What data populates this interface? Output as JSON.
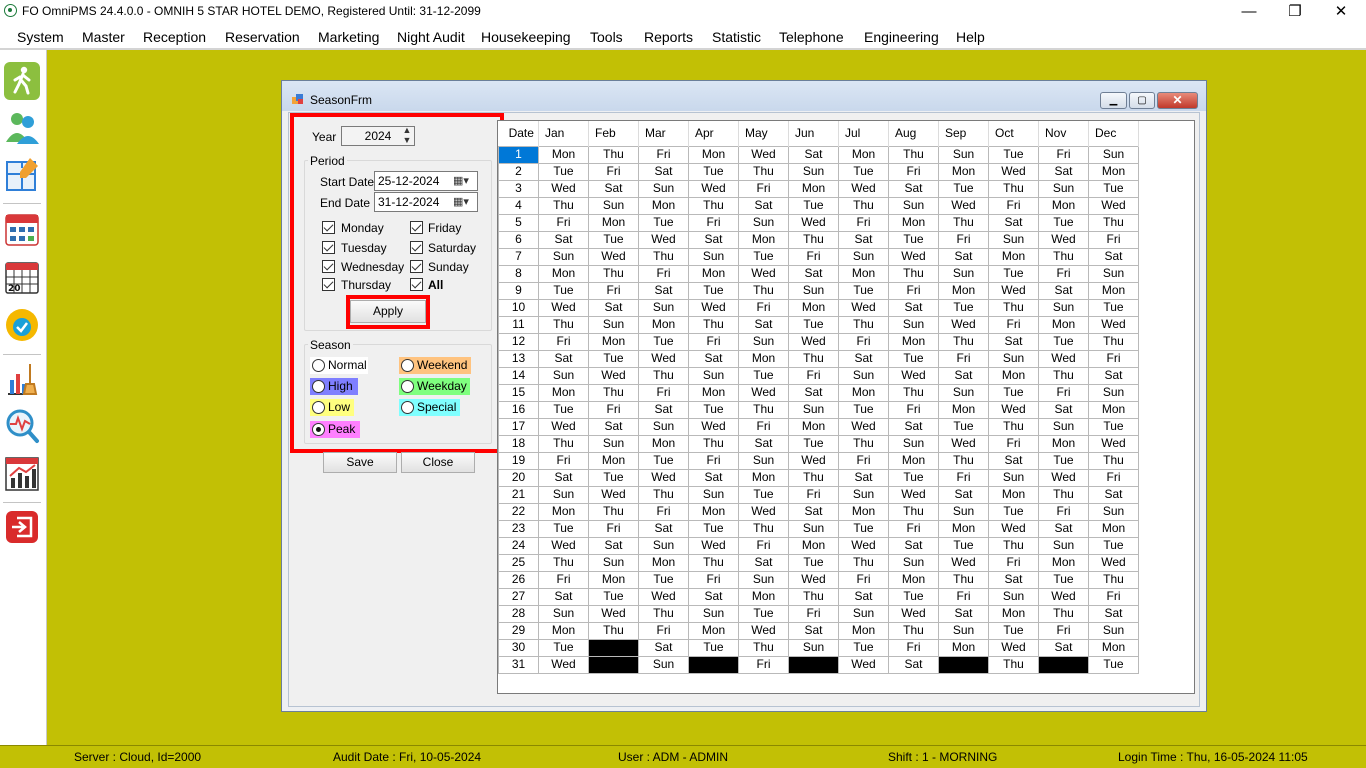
{
  "window": {
    "title": "FO OmniPMS 24.4.0.0 - OMNIH 5 STAR HOTEL DEMO, Registered Until: 31-12-2099"
  },
  "menu": [
    "System",
    "Master",
    "Reception",
    "Reservation",
    "Marketing",
    "Night Audit",
    "Housekeeping",
    "Tools",
    "Reports",
    "Statistic",
    "Telephone",
    "Engineering",
    "Help"
  ],
  "toolbar": [
    "walk-in-icon",
    "guests-icon",
    "floor-plan-icon",
    "calendar-grid-icon",
    "calendar-2023-icon",
    "badge-check-icon",
    "housekeeping-icon",
    "analytics-icon",
    "chart-icon",
    "exit-icon"
  ],
  "status": {
    "server": "Server : Cloud, Id=2000",
    "audit": "Audit Date : Fri, 10-05-2024",
    "user": "User : ADM - ADMIN",
    "shift": "Shift : 1 - MORNING",
    "login": "Login Time : Thu, 16-05-2024 11:05"
  },
  "dialog": {
    "title": "SeasonFrm",
    "year_label": "Year",
    "year_value": "2024",
    "period_label": "Period",
    "start_label": "Start Date",
    "start_value": "25-12-2024",
    "end_label": "End Date",
    "end_value": "31-12-2024",
    "days": {
      "monday": "Monday",
      "tuesday": "Tuesday",
      "wednesday": "Wednesday",
      "thursday": "Thursday",
      "friday": "Friday",
      "saturday": "Saturday",
      "sunday": "Sunday",
      "all": "All"
    },
    "apply_label": "Apply",
    "season_label": "Season",
    "seasons": {
      "normal": "Normal",
      "high": "High",
      "low": "Low",
      "peak": "Peak",
      "weekend": "Weekend",
      "weekday": "Weekday",
      "special": "Special"
    },
    "selected_season": "Peak",
    "season_colors": {
      "normal": "#ffffff",
      "high": "#7f7fff",
      "low": "#ffff7f",
      "peak": "#ff7fff",
      "weekend": "#ffc37f",
      "weekday": "#7fff7f",
      "special": "#7fffff"
    },
    "save_label": "Save",
    "close_label": "Close"
  },
  "grid": {
    "columns": [
      "Date",
      "Jan",
      "Feb",
      "Mar",
      "Apr",
      "May",
      "Jun",
      "Jul",
      "Aug",
      "Sep",
      "Oct",
      "Nov",
      "Dec"
    ],
    "rows": [
      [
        "1",
        "Mon",
        "Thu",
        "Fri",
        "Mon",
        "Wed",
        "Sat",
        "Mon",
        "Thu",
        "Sun",
        "Tue",
        "Fri",
        "Sun"
      ],
      [
        "2",
        "Tue",
        "Fri",
        "Sat",
        "Tue",
        "Thu",
        "Sun",
        "Tue",
        "Fri",
        "Mon",
        "Wed",
        "Sat",
        "Mon"
      ],
      [
        "3",
        "Wed",
        "Sat",
        "Sun",
        "Wed",
        "Fri",
        "Mon",
        "Wed",
        "Sat",
        "Tue",
        "Thu",
        "Sun",
        "Tue"
      ],
      [
        "4",
        "Thu",
        "Sun",
        "Mon",
        "Thu",
        "Sat",
        "Tue",
        "Thu",
        "Sun",
        "Wed",
        "Fri",
        "Mon",
        "Wed"
      ],
      [
        "5",
        "Fri",
        "Mon",
        "Tue",
        "Fri",
        "Sun",
        "Wed",
        "Fri",
        "Mon",
        "Thu",
        "Sat",
        "Tue",
        "Thu"
      ],
      [
        "6",
        "Sat",
        "Tue",
        "Wed",
        "Sat",
        "Mon",
        "Thu",
        "Sat",
        "Tue",
        "Fri",
        "Sun",
        "Wed",
        "Fri"
      ],
      [
        "7",
        "Sun",
        "Wed",
        "Thu",
        "Sun",
        "Tue",
        "Fri",
        "Sun",
        "Wed",
        "Sat",
        "Mon",
        "Thu",
        "Sat"
      ],
      [
        "8",
        "Mon",
        "Thu",
        "Fri",
        "Mon",
        "Wed",
        "Sat",
        "Mon",
        "Thu",
        "Sun",
        "Tue",
        "Fri",
        "Sun"
      ],
      [
        "9",
        "Tue",
        "Fri",
        "Sat",
        "Tue",
        "Thu",
        "Sun",
        "Tue",
        "Fri",
        "Mon",
        "Wed",
        "Sat",
        "Mon"
      ],
      [
        "10",
        "Wed",
        "Sat",
        "Sun",
        "Wed",
        "Fri",
        "Mon",
        "Wed",
        "Sat",
        "Tue",
        "Thu",
        "Sun",
        "Tue"
      ],
      [
        "11",
        "Thu",
        "Sun",
        "Mon",
        "Thu",
        "Sat",
        "Tue",
        "Thu",
        "Sun",
        "Wed",
        "Fri",
        "Mon",
        "Wed"
      ],
      [
        "12",
        "Fri",
        "Mon",
        "Tue",
        "Fri",
        "Sun",
        "Wed",
        "Fri",
        "Mon",
        "Thu",
        "Sat",
        "Tue",
        "Thu"
      ],
      [
        "13",
        "Sat",
        "Tue",
        "Wed",
        "Sat",
        "Mon",
        "Thu",
        "Sat",
        "Tue",
        "Fri",
        "Sun",
        "Wed",
        "Fri"
      ],
      [
        "14",
        "Sun",
        "Wed",
        "Thu",
        "Sun",
        "Tue",
        "Fri",
        "Sun",
        "Wed",
        "Sat",
        "Mon",
        "Thu",
        "Sat"
      ],
      [
        "15",
        "Mon",
        "Thu",
        "Fri",
        "Mon",
        "Wed",
        "Sat",
        "Mon",
        "Thu",
        "Sun",
        "Tue",
        "Fri",
        "Sun"
      ],
      [
        "16",
        "Tue",
        "Fri",
        "Sat",
        "Tue",
        "Thu",
        "Sun",
        "Tue",
        "Fri",
        "Mon",
        "Wed",
        "Sat",
        "Mon"
      ],
      [
        "17",
        "Wed",
        "Sat",
        "Sun",
        "Wed",
        "Fri",
        "Mon",
        "Wed",
        "Sat",
        "Tue",
        "Thu",
        "Sun",
        "Tue"
      ],
      [
        "18",
        "Thu",
        "Sun",
        "Mon",
        "Thu",
        "Sat",
        "Tue",
        "Thu",
        "Sun",
        "Wed",
        "Fri",
        "Mon",
        "Wed"
      ],
      [
        "19",
        "Fri",
        "Mon",
        "Tue",
        "Fri",
        "Sun",
        "Wed",
        "Fri",
        "Mon",
        "Thu",
        "Sat",
        "Tue",
        "Thu"
      ],
      [
        "20",
        "Sat",
        "Tue",
        "Wed",
        "Sat",
        "Mon",
        "Thu",
        "Sat",
        "Tue",
        "Fri",
        "Sun",
        "Wed",
        "Fri"
      ],
      [
        "21",
        "Sun",
        "Wed",
        "Thu",
        "Sun",
        "Tue",
        "Fri",
        "Sun",
        "Wed",
        "Sat",
        "Mon",
        "Thu",
        "Sat"
      ],
      [
        "22",
        "Mon",
        "Thu",
        "Fri",
        "Mon",
        "Wed",
        "Sat",
        "Mon",
        "Thu",
        "Sun",
        "Tue",
        "Fri",
        "Sun"
      ],
      [
        "23",
        "Tue",
        "Fri",
        "Sat",
        "Tue",
        "Thu",
        "Sun",
        "Tue",
        "Fri",
        "Mon",
        "Wed",
        "Sat",
        "Mon"
      ],
      [
        "24",
        "Wed",
        "Sat",
        "Sun",
        "Wed",
        "Fri",
        "Mon",
        "Wed",
        "Sat",
        "Tue",
        "Thu",
        "Sun",
        "Tue"
      ],
      [
        "25",
        "Thu",
        "Sun",
        "Mon",
        "Thu",
        "Sat",
        "Tue",
        "Thu",
        "Sun",
        "Wed",
        "Fri",
        "Mon",
        "Wed"
      ],
      [
        "26",
        "Fri",
        "Mon",
        "Tue",
        "Fri",
        "Sun",
        "Wed",
        "Fri",
        "Mon",
        "Thu",
        "Sat",
        "Tue",
        "Thu"
      ],
      [
        "27",
        "Sat",
        "Tue",
        "Wed",
        "Sat",
        "Mon",
        "Thu",
        "Sat",
        "Tue",
        "Fri",
        "Sun",
        "Wed",
        "Fri"
      ],
      [
        "28",
        "Sun",
        "Wed",
        "Thu",
        "Sun",
        "Tue",
        "Fri",
        "Sun",
        "Wed",
        "Sat",
        "Mon",
        "Thu",
        "Sat"
      ],
      [
        "29",
        "Mon",
        "Thu",
        "Fri",
        "Mon",
        "Wed",
        "Sat",
        "Mon",
        "Thu",
        "Sun",
        "Tue",
        "Fri",
        "Sun"
      ],
      [
        "30",
        "Tue",
        "",
        "Sat",
        "Tue",
        "Thu",
        "Sun",
        "Tue",
        "Fri",
        "Mon",
        "Wed",
        "Sat",
        "Mon"
      ],
      [
        "31",
        "Wed",
        "",
        "Sun",
        "",
        "Fri",
        "",
        "Wed",
        "Sat",
        "",
        "Thu",
        "",
        "Tue"
      ]
    ],
    "blank_cells": [
      [
        29,
        2
      ],
      [
        30,
        2
      ],
      [
        30,
        4
      ],
      [
        30,
        6
      ],
      [
        30,
        9
      ],
      [
        30,
        11
      ]
    ]
  }
}
